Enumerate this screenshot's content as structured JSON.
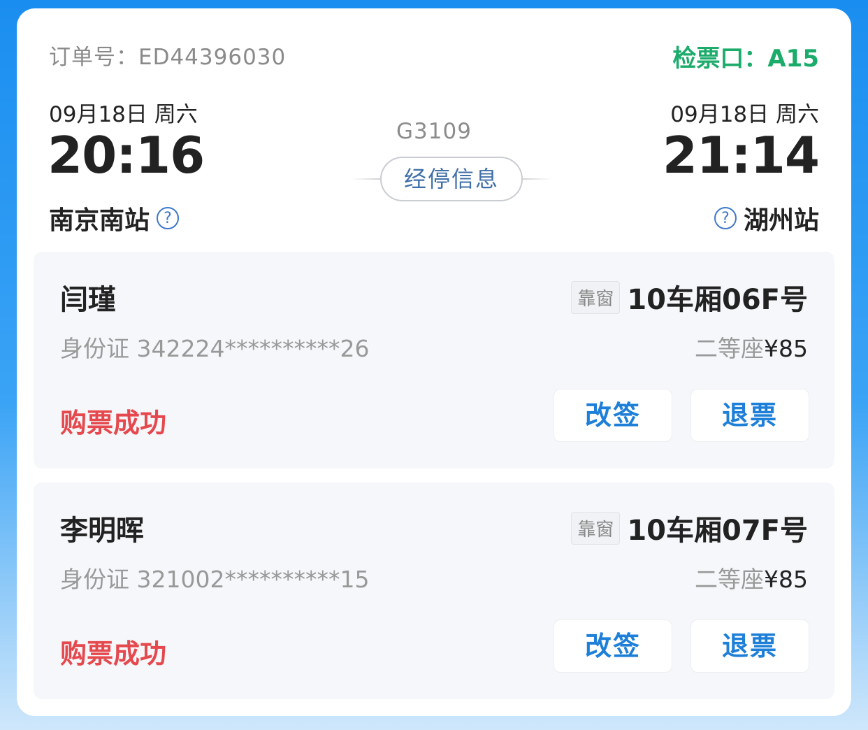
{
  "order": {
    "number": "订单号：ED44396030",
    "gate": "检票口：A15"
  },
  "trip": {
    "departure": {
      "date": "09月18日  周六",
      "time": "20:16",
      "station": "南京南站"
    },
    "arrival": {
      "date": "09月18日  周六",
      "time": "21:14",
      "station": "湖州站"
    },
    "train_no": "G3109",
    "stops_label": "经停信息",
    "help_glyph": "?"
  },
  "passengers": [
    {
      "name": "闫瑾",
      "window_tag": "靠窗",
      "seat": "10车厢06F号",
      "id_text": "身份证 342224**********26",
      "seat_class": "二等座",
      "price": "¥85",
      "status": "购票成功",
      "change_label": "改签",
      "refund_label": "退票"
    },
    {
      "name": "李明晖",
      "window_tag": "靠窗",
      "seat": "10车厢07F号",
      "id_text": "身份证 321002**********15",
      "seat_class": "二等座",
      "price": "¥85",
      "status": "购票成功",
      "change_label": "改签",
      "refund_label": "退票"
    }
  ],
  "colors": {
    "gate": "#1bab6a",
    "status": "#e5484d",
    "action": "#1e7fd8",
    "background": "#1a8ef0"
  }
}
